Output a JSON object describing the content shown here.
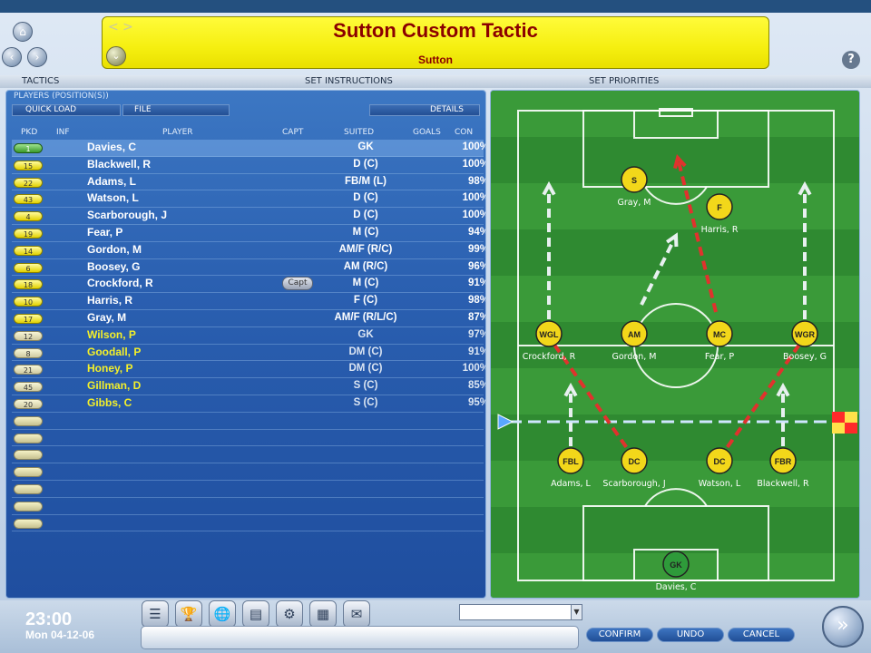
{
  "header": {
    "title": "Sutton Custom Tactic",
    "subtitle": "Sutton",
    "arrows": "< >",
    "help": "?"
  },
  "tabs": [
    {
      "label": "TACTICS"
    },
    {
      "label": "SET INSTRUCTIONS"
    },
    {
      "label": "SET PRIORITIES"
    }
  ],
  "players_panel": {
    "label": "PLAYERS (POSITION(S))",
    "quick_load": "QUICK LOAD",
    "file": "FILE",
    "details": "DETAILS",
    "columns": [
      "PKD",
      "INF",
      "PLAYER",
      "CAPT",
      "SUITED",
      "GOALS",
      "CON"
    ],
    "capt_label": "Capt",
    "rows": [
      {
        "pkd": "1",
        "name": "Davies, C",
        "suited": "GK",
        "con": "100%",
        "kind": "green",
        "sub": false,
        "selected": true
      },
      {
        "pkd": "15",
        "name": "Blackwell, R",
        "suited": "D (C)",
        "con": "100%",
        "kind": "yellow",
        "sub": false
      },
      {
        "pkd": "22",
        "name": "Adams, L",
        "suited": "FB/M (L)",
        "con": "98%",
        "kind": "yellow",
        "sub": false
      },
      {
        "pkd": "43",
        "name": "Watson, L",
        "suited": "D (C)",
        "con": "100%",
        "kind": "yellow",
        "sub": false
      },
      {
        "pkd": "4",
        "name": "Scarborough, J",
        "suited": "D (C)",
        "con": "100%",
        "kind": "yellow",
        "sub": false
      },
      {
        "pkd": "19",
        "name": "Fear, P",
        "suited": "M (C)",
        "con": "94%",
        "kind": "yellow",
        "sub": false
      },
      {
        "pkd": "14",
        "name": "Gordon, M",
        "suited": "AM/F (R/C)",
        "con": "99%",
        "kind": "yellow",
        "sub": false
      },
      {
        "pkd": "6",
        "name": "Boosey, G",
        "suited": "AM (R/C)",
        "con": "96%",
        "kind": "yellow",
        "sub": false
      },
      {
        "pkd": "18",
        "name": "Crockford, R",
        "suited": "M (C)",
        "con": "91%",
        "kind": "yellow",
        "sub": false,
        "captain": true
      },
      {
        "pkd": "10",
        "name": "Harris, R",
        "suited": "F (C)",
        "con": "98%",
        "kind": "yellow",
        "sub": false
      },
      {
        "pkd": "17",
        "name": "Gray, M",
        "suited": "AM/F (R/L/C)",
        "con": "87%",
        "kind": "yellow",
        "sub": false
      },
      {
        "pkd": "12",
        "name": "Wilson, P",
        "suited": "GK",
        "con": "97%",
        "kind": "grey",
        "sub": true
      },
      {
        "pkd": "8",
        "name": "Goodall, P",
        "suited": "DM (C)",
        "con": "91%",
        "kind": "grey",
        "sub": true
      },
      {
        "pkd": "21",
        "name": "Honey, P",
        "suited": "DM (C)",
        "con": "100%",
        "kind": "grey",
        "sub": true
      },
      {
        "pkd": "45",
        "name": "Gillman, D",
        "suited": "S (C)",
        "con": "85%",
        "kind": "grey",
        "sub": true
      },
      {
        "pkd": "20",
        "name": "Gibbs, C",
        "suited": "S (C)",
        "con": "95%",
        "kind": "grey",
        "sub": true
      }
    ],
    "empty_rows": 7
  },
  "pitch": {
    "players": [
      {
        "pos": "S",
        "name": "Gray, M",
        "color": "#f2d71a"
      },
      {
        "pos": "F",
        "name": "Harris, R",
        "color": "#f2d71a"
      },
      {
        "pos": "WGL",
        "name": "Crockford, R",
        "color": "#f2d71a"
      },
      {
        "pos": "AM",
        "name": "Gordon, M",
        "color": "#f2d71a"
      },
      {
        "pos": "MC",
        "name": "Fear, P",
        "color": "#f2d71a"
      },
      {
        "pos": "WGR",
        "name": "Boosey, G",
        "color": "#f2d71a"
      },
      {
        "pos": "FBL",
        "name": "Adams, L",
        "color": "#f2d71a"
      },
      {
        "pos": "DC",
        "name": "Scarborough, J",
        "color": "#f2d71a"
      },
      {
        "pos": "DC",
        "name": "Watson, L",
        "color": "#f2d71a"
      },
      {
        "pos": "FBR",
        "name": "Blackwell, R",
        "color": "#f2d71a"
      },
      {
        "pos": "GK",
        "name": "Davies, C",
        "color": "#2e9a3a"
      }
    ]
  },
  "footer": {
    "time": "23:00",
    "date": "Mon 04-12-06",
    "confirm": "CONFIRM",
    "undo": "UNDO",
    "cancel": "CANCEL",
    "go": "»"
  }
}
